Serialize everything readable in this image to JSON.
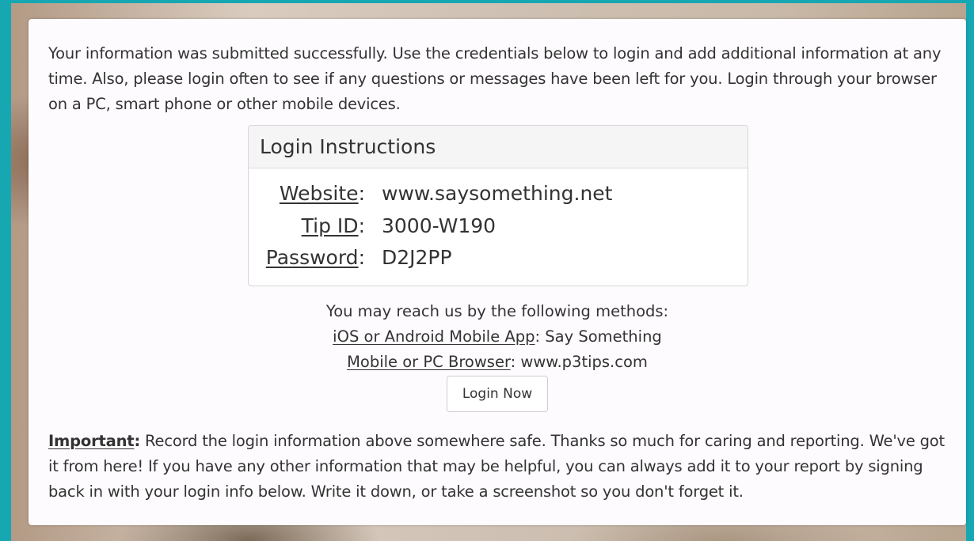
{
  "card": {
    "intro_text": "Your information was submitted successfully. Use the credentials below to login and add additional information at any time. Also, please login often to see if any questions or messages have been left for you. Login through your browser on a PC, smart phone or other mobile devices."
  },
  "login_instructions": {
    "heading": "Login Instructions",
    "website_label": "Website",
    "website_value": "www.saysomething.net",
    "tipid_label": "Tip ID",
    "tipid_value": "3000-W190",
    "password_label": "Password",
    "password_value": "D2J2PP",
    "separator": ":"
  },
  "contact": {
    "intro": "You may reach us by the following methods:",
    "app_label": "iOS or Android Mobile App",
    "app_value": ": Say Something",
    "browser_label": "Mobile or PC Browser",
    "browser_value": ": www.p3tips.com"
  },
  "login_button": {
    "label": "Login Now"
  },
  "important": {
    "label": "Important",
    "separator": ":",
    "text": " Record the login information above somewhere safe. Thanks so much for caring and reporting. We've got it from here! If you have any other information that may be helpful, you can always add it to your report by signing back in with your login info below. Write it down, or take a screenshot so you don't forget it."
  },
  "colors": {
    "frame_accent": "#17a7b3",
    "card_background": "#fdfbfd",
    "panel_heading_background": "#f5f5f5",
    "text": "#333333"
  }
}
